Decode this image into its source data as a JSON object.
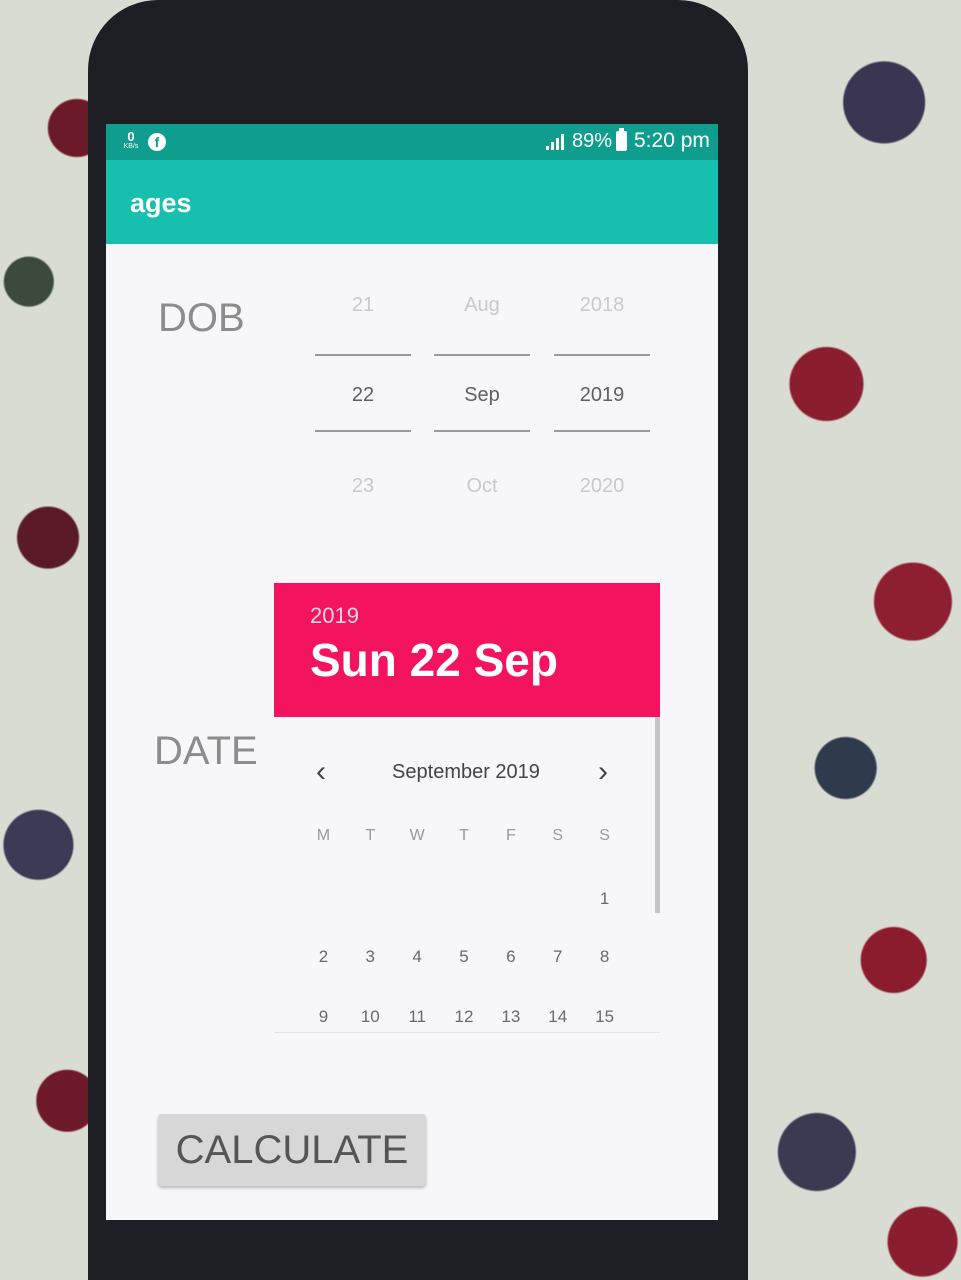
{
  "status_bar": {
    "net_speed_value": "0",
    "net_speed_unit": "KB/s",
    "facebook_glyph": "f",
    "battery": "89%",
    "time": "5:20 pm"
  },
  "app_bar": {
    "title": "ages"
  },
  "dob": {
    "label": "DOB",
    "day": {
      "prev": "21",
      "current": "22",
      "next": "23"
    },
    "month": {
      "prev": "Aug",
      "current": "Sep",
      "next": "Oct"
    },
    "year": {
      "prev": "2018",
      "current": "2019",
      "next": "2020"
    }
  },
  "date": {
    "label": "DATE",
    "header": {
      "year": "2019",
      "selected": "Sun 22 Sep"
    },
    "calendar": {
      "month_title": "September 2019",
      "prev_glyph": "‹",
      "next_glyph": "›",
      "weekdays": [
        "M",
        "T",
        "W",
        "T",
        "F",
        "S",
        "S"
      ],
      "weeks": [
        [
          "",
          "",
          "",
          "",
          "",
          "",
          "1"
        ],
        [
          "2",
          "3",
          "4",
          "5",
          "6",
          "7",
          "8"
        ],
        [
          "9",
          "10",
          "11",
          "12",
          "13",
          "14",
          "15"
        ]
      ]
    }
  },
  "button": {
    "calculate": "CALCULATE"
  },
  "colors": {
    "status_bar": "#0f9e8e",
    "app_bar": "#17bfae",
    "accent": "#f4135f",
    "screen_bg": "#f7f6f8"
  }
}
